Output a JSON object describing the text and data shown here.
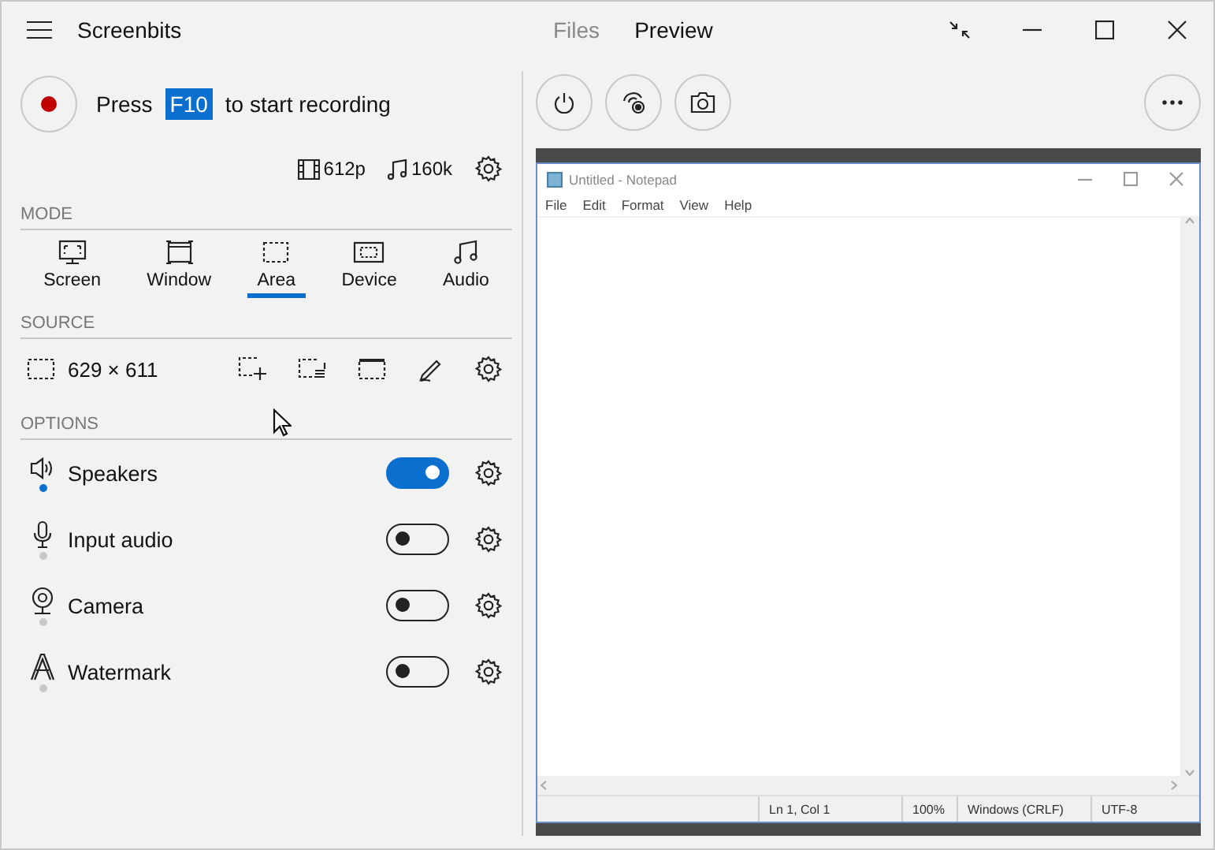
{
  "window": {
    "title": "Screenbits",
    "tabs": [
      {
        "label": "Files",
        "selected": false
      },
      {
        "label": "Preview",
        "selected": true
      }
    ]
  },
  "record": {
    "prefix": "Press",
    "key": "F10",
    "suffix": "to start recording"
  },
  "quality": {
    "video": "612p",
    "audio": "160k"
  },
  "mode": {
    "heading": "MODE",
    "items": [
      {
        "kind": "screen",
        "label": "Screen",
        "selected": false
      },
      {
        "kind": "window",
        "label": "Window",
        "selected": false
      },
      {
        "kind": "area",
        "label": "Area",
        "selected": true
      },
      {
        "kind": "device",
        "label": "Device",
        "selected": false
      },
      {
        "kind": "audio",
        "label": "Audio",
        "selected": false
      }
    ]
  },
  "source": {
    "heading": "SOURCE",
    "size": "629 × 611"
  },
  "options": {
    "heading": "OPTIONS",
    "items": [
      {
        "kind": "speaker",
        "label": "Speakers",
        "on": true
      },
      {
        "kind": "mic",
        "label": "Input audio",
        "on": false
      },
      {
        "kind": "camera",
        "label": "Camera",
        "on": false
      },
      {
        "kind": "watermark",
        "label": "Watermark",
        "on": false
      }
    ]
  },
  "notepad": {
    "title": "Untitled - Notepad",
    "menu": [
      "File",
      "Edit",
      "Format",
      "View",
      "Help"
    ],
    "status": [
      "Ln 1, Col 1",
      "100%",
      "Windows (CRLF)",
      "UTF-8"
    ]
  }
}
